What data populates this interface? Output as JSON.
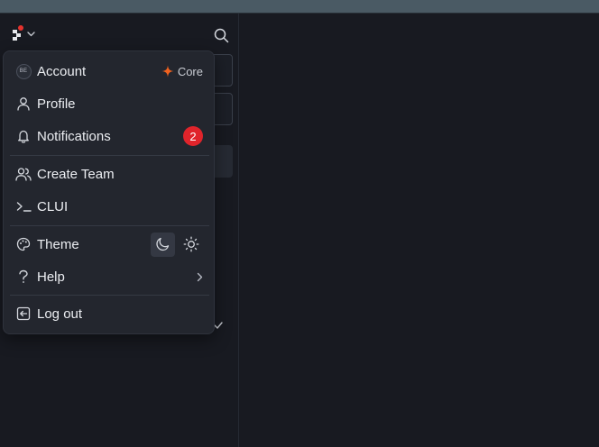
{
  "menu": {
    "account": {
      "avatar_initials": "BE",
      "label": "Account",
      "plan_label": "Core"
    },
    "profile": {
      "label": "Profile"
    },
    "notifications": {
      "label": "Notifications",
      "count": "2"
    },
    "create_team": {
      "label": "Create Team"
    },
    "clui": {
      "label": "CLUI"
    },
    "theme": {
      "label": "Theme",
      "options": [
        "dark",
        "light"
      ],
      "selected": "dark"
    },
    "help": {
      "label": "Help"
    },
    "logout": {
      "label": "Log out"
    }
  },
  "colors": {
    "accent_plan": "#f0621f",
    "badge": "#e0242b",
    "logo_dot": "#e5322d",
    "background": "#181a21",
    "menu_background": "#23262e"
  },
  "icons": {
    "workspace": "logo-icon",
    "workspace_caret": "chevron-down-icon",
    "search": "search-icon",
    "plan": "sparkle-icon",
    "profile": "user-icon",
    "notifications": "bell-icon",
    "create_team": "users-icon",
    "clui": "terminal-icon",
    "theme": "palette-icon",
    "theme_dark": "moon-icon",
    "theme_light": "sun-icon",
    "help": "question-icon",
    "help_more": "chevron-right-icon",
    "logout": "logout-icon"
  }
}
